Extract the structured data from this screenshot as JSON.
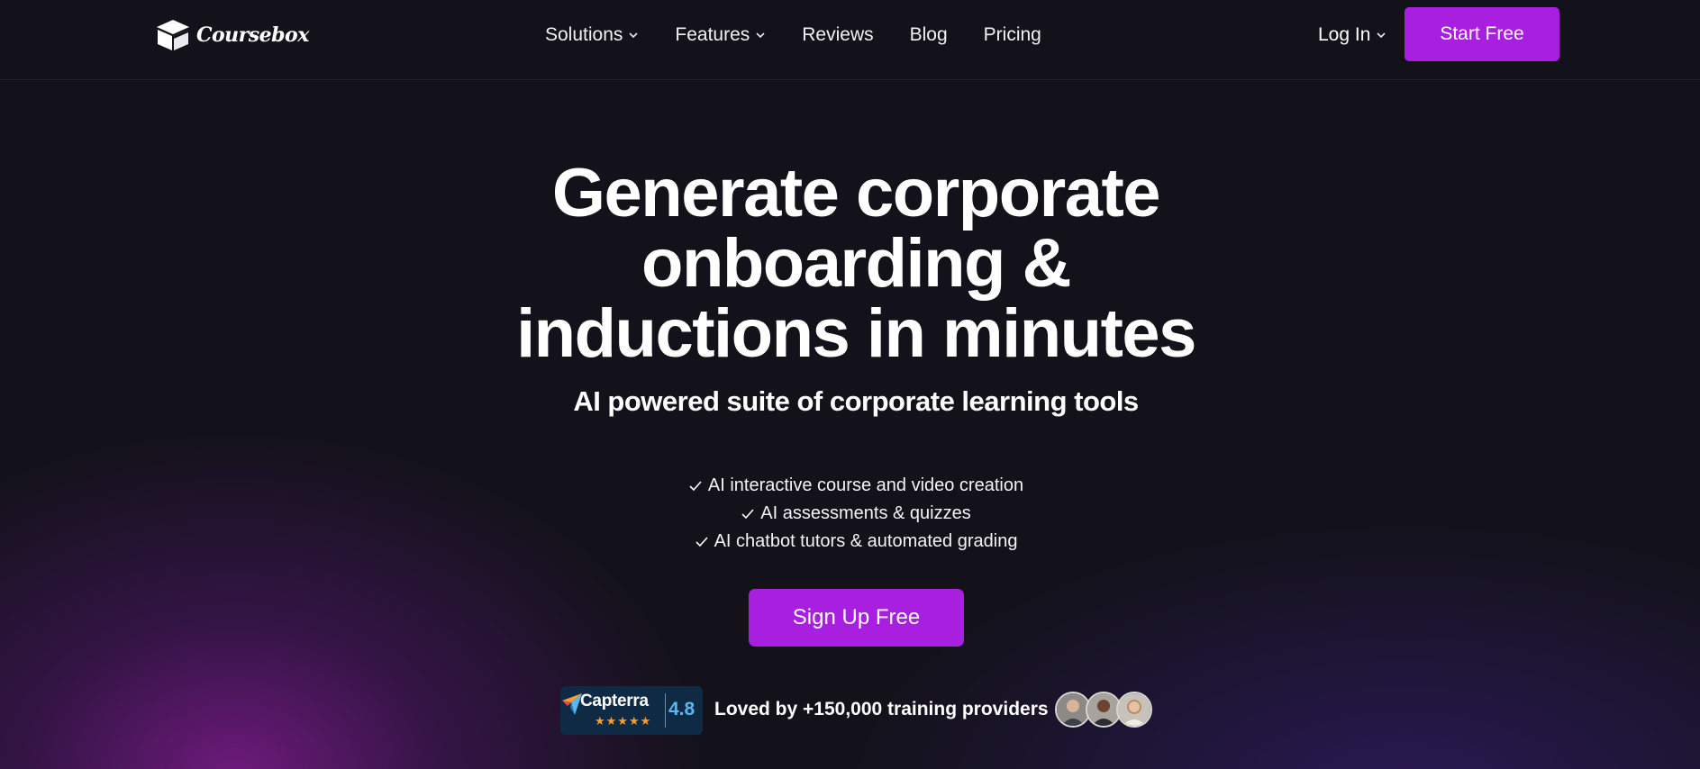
{
  "header": {
    "logo_text": "Coursebox",
    "nav": [
      {
        "label": "Solutions",
        "has_dropdown": true
      },
      {
        "label": "Features",
        "has_dropdown": true
      },
      {
        "label": "Reviews",
        "has_dropdown": false
      },
      {
        "label": "Blog",
        "has_dropdown": false
      },
      {
        "label": "Pricing",
        "has_dropdown": false
      }
    ],
    "login_label": "Log In",
    "start_label": "Start Free"
  },
  "hero": {
    "title_lines": [
      "Generate corporate",
      "onboarding &",
      "inductions in minutes"
    ],
    "subtitle": "AI powered suite of corporate learning tools",
    "bullets": [
      "AI interactive course and video creation",
      "AI assessments & quizzes",
      "AI chatbot tutors & automated grading"
    ],
    "cta_label": "Sign Up Free"
  },
  "social_proof": {
    "capterra_name": "Capterra",
    "capterra_stars": "★★★★★",
    "capterra_rating": "4.8",
    "loved_text": "Loved by +150,000 training providers"
  },
  "colors": {
    "accent": "#a91fe0",
    "background": "#13121a",
    "capterra_bg": "#0e2a45",
    "capterra_score": "#5bb7f0",
    "star": "#ff9d28"
  }
}
